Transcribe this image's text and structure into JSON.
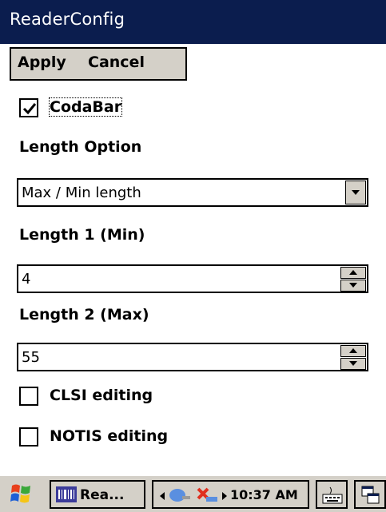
{
  "window": {
    "title": "ReaderConfig"
  },
  "menu": {
    "apply_label": "Apply",
    "cancel_label": "Cancel"
  },
  "form": {
    "codabar": {
      "label": "CodaBar",
      "checked": true
    },
    "length_option": {
      "label": "Length Option",
      "value": "Max / Min length"
    },
    "length1": {
      "label": "Length 1 (Min)",
      "value": "4"
    },
    "length2": {
      "label": "Length 2 (Max)",
      "value": "55"
    },
    "clsi": {
      "label": "CLSI editing",
      "checked": false
    },
    "notis": {
      "label": "NOTIS editing",
      "checked": false
    }
  },
  "taskbar": {
    "task_label": "Rea...",
    "clock": "10:37 AM",
    "start_icon": "windows-flag-icon",
    "keyboard_icon": "keyboard-icon",
    "desktop_icon": "desktop-icon"
  },
  "colors": {
    "titlebar": "#0b1d4e",
    "chrome": "#d4d0c8"
  }
}
